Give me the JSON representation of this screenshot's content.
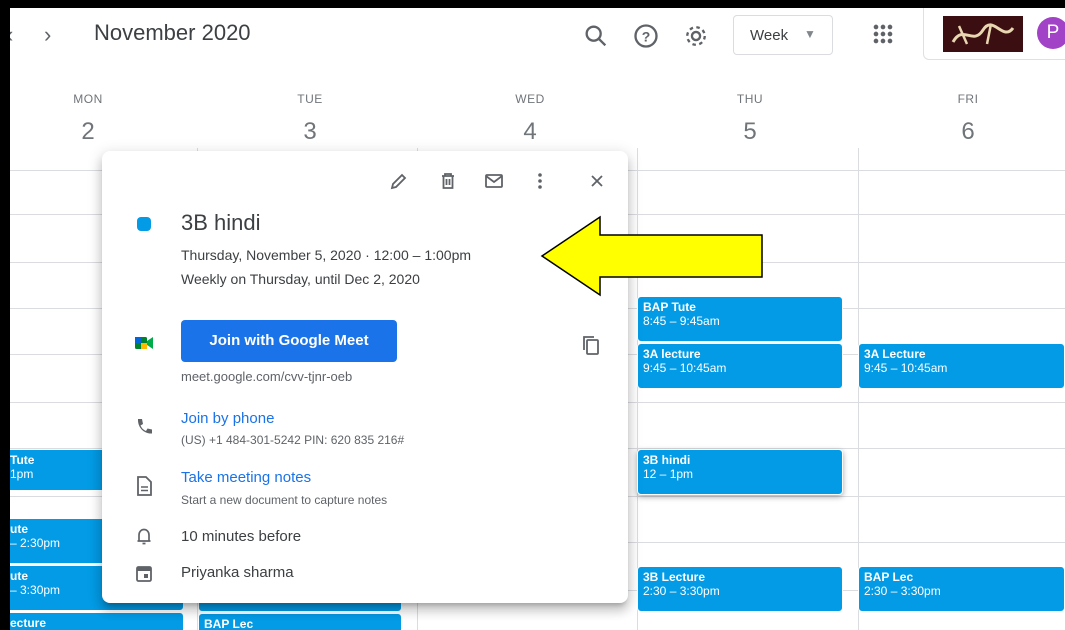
{
  "header": {
    "month_title": "November 2020",
    "view": "Week",
    "account_initial": "P"
  },
  "days": [
    {
      "name": "MON",
      "num": "2"
    },
    {
      "name": "TUE",
      "num": "3"
    },
    {
      "name": "WED",
      "num": "4"
    },
    {
      "name": "THU",
      "num": "5"
    },
    {
      "name": "FRI",
      "num": "6"
    }
  ],
  "events": {
    "mon_tute": {
      "title": "Tute",
      "time": "1pm"
    },
    "mon_ute": {
      "title": "ute",
      "time": "– 2:30pm"
    },
    "mon_ute2": {
      "title": "ute",
      "time": "– 3:30pm"
    },
    "mon_lecture": {
      "title": "ecture",
      "time": ""
    },
    "tue_baplec": {
      "title": "BAP Lec",
      "time": ""
    },
    "thu_bap_tute": {
      "title": "BAP Tute",
      "time": "8:45 – 9:45am"
    },
    "thu_3a": {
      "title": "3A lecture",
      "time": "9:45 – 10:45am"
    },
    "thu_3b": {
      "title": "3B hindi",
      "time": "12 – 1pm"
    },
    "thu_3b_lecture": {
      "title": "3B Lecture",
      "time": "2:30 – 3:30pm"
    },
    "fri_3a": {
      "title": "3A Lecture",
      "time": "9:45 – 10:45am"
    },
    "fri_bap_lec": {
      "title": "BAP Lec",
      "time": "2:30 – 3:30pm"
    }
  },
  "popup": {
    "title": "3B hindi",
    "datetime": "Thursday, November 5, 2020  ·  12:00 – 1:00pm",
    "recurrence": "Weekly on Thursday, until Dec 2, 2020",
    "meet_button": "Join with Google Meet",
    "meet_url": "meet.google.com/cvv-tjnr-oeb",
    "phone_link": "Join by phone",
    "phone_detail": "(US) +1 484-301-5242 PIN: 620 835 216#",
    "notes_link": "Take meeting notes",
    "notes_detail": "Start a new document to capture notes",
    "reminder": "10 minutes before",
    "organizer": "Priyanka sharma",
    "color": "#039be5"
  },
  "colors": {
    "event": "#039be5",
    "primary": "#1a73e8",
    "arrow": "#ffff00"
  }
}
